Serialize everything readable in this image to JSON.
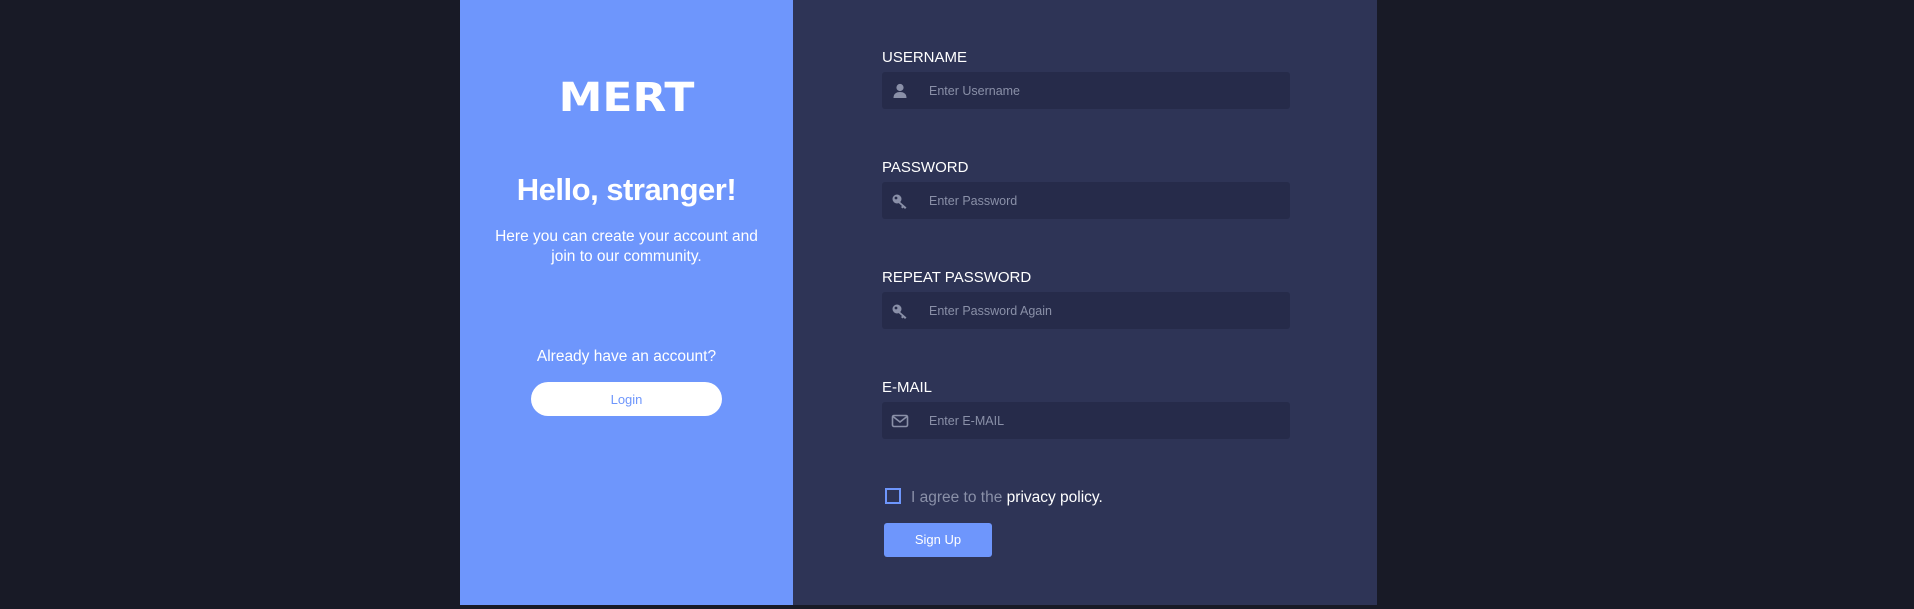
{
  "brand": {
    "logo": "MERT"
  },
  "welcome": {
    "heading": "Hello, stranger!",
    "subtitle": "Here you can create your account and join to our community.",
    "already_text": "Already have an account?",
    "login_label": "Login"
  },
  "form": {
    "username": {
      "label": "USERNAME",
      "placeholder": "Enter Username",
      "value": "",
      "icon": "user-icon"
    },
    "password": {
      "label": "PASSWORD",
      "placeholder": "Enter Password",
      "value": "",
      "icon": "key-icon"
    },
    "repeat_password": {
      "label": "REPEAT PASSWORD",
      "placeholder": "Enter Password Again",
      "value": "",
      "icon": "key-icon"
    },
    "email": {
      "label": "E-MAIL",
      "placeholder": "Enter E-MAIL",
      "value": "",
      "icon": "envelope-icon"
    },
    "agree_prefix": "I agree to the",
    "agree_link": "privacy policy.",
    "agree_checked": false,
    "signup_label": "Sign Up"
  },
  "colors": {
    "page_background": "#181a26",
    "accent": "#6e96fc",
    "form_panel": "#2e3456",
    "input_background": "#262b4a",
    "muted_text": "#8a90a8"
  }
}
